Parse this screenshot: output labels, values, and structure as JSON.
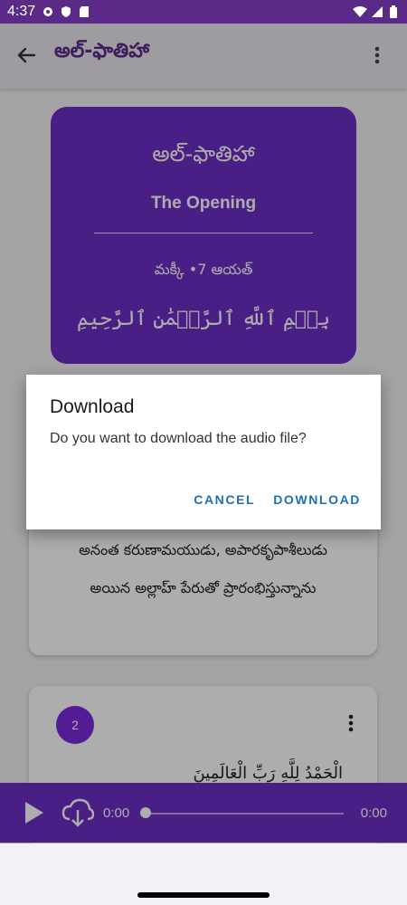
{
  "status_bar": {
    "time": "4:37",
    "left_icons": [
      "gear-icon",
      "shield-icon",
      "sd-card-icon"
    ],
    "right_icons": [
      "wifi-icon",
      "signal-icon",
      "battery-icon"
    ]
  },
  "app_bar": {
    "title": "అల్-ఫాతిహా"
  },
  "surah_header": {
    "name_telugu": "అల్-ఫాతిహా",
    "name_english": "The Opening",
    "meta": "మక్కీ •7 ఆయత్",
    "bismillah": "بِسۡمِ ٱللَّهِ ٱلرَّحۡمَٰنِ ٱلرَّحِيمِ"
  },
  "ayah_cards": [
    {
      "line_1": "అనంత కరుణామయుడు, అపారకృపాశీలుడు",
      "line_2": "అయిన అల్లాహ్ పేరుతో ప్రారంభిస్తున్నాను"
    },
    {
      "number": "2",
      "arabic": "الْحَمْدُ لِلَّهِ رَبِّ الْعَالَمِينَ"
    }
  ],
  "player": {
    "time_start": "0:00",
    "time_end": "0:00",
    "progress": 0
  },
  "dialog": {
    "title": "Download",
    "message": "Do you want to download the audio file?",
    "cancel_label": "CANCEL",
    "download_label": "DOWNLOAD"
  },
  "colors": {
    "primary": "#6d2fc5",
    "status_bar": "#5b2a88",
    "accent_button": "#1e6fb5",
    "ayah_badge": "#7a2bdb"
  }
}
